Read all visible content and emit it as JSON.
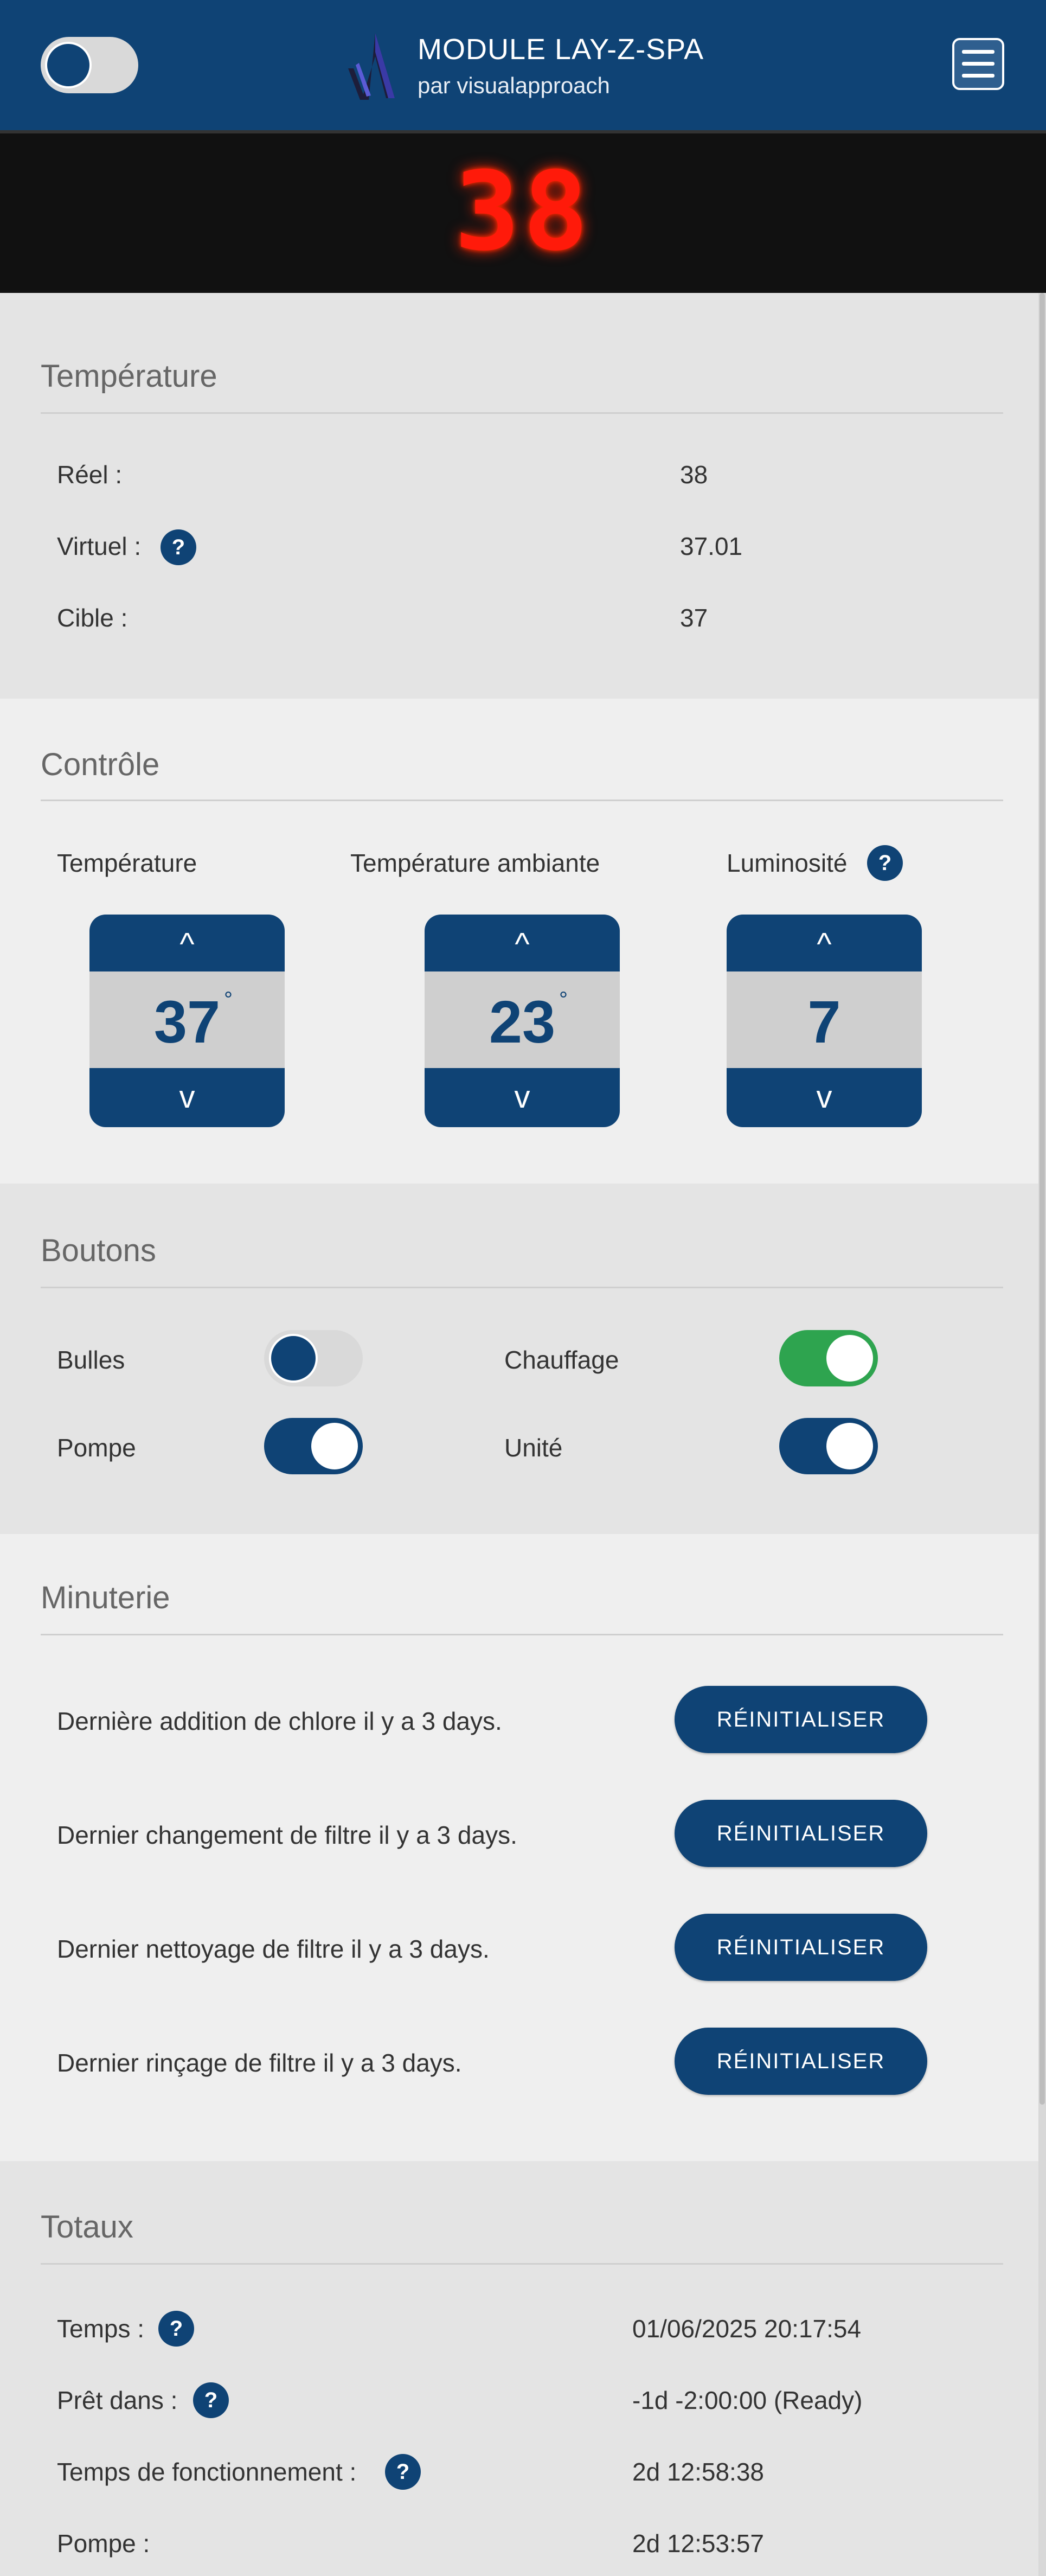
{
  "header": {
    "title": "MODULE LAY-Z-SPA",
    "subtitle": "par visualapproach",
    "power_toggle": "off",
    "logo_icon": "va-logo-icon",
    "menu_icon": "hamburger-menu-icon"
  },
  "display": {
    "value": "38",
    "color": "#ff1a0a"
  },
  "temperature": {
    "title": "Température",
    "rows": [
      {
        "label": "Réel :",
        "value": "38",
        "help": false
      },
      {
        "label": "Virtuel :",
        "value": "37.01",
        "help": true
      },
      {
        "label": "Cible :",
        "value": "37",
        "help": false
      }
    ]
  },
  "control": {
    "title": "Contrôle",
    "spinners": [
      {
        "label": "Température",
        "value": "37",
        "unit": "°",
        "help": false
      },
      {
        "label": "Température ambiante",
        "value": "23",
        "unit": "°",
        "help": true
      },
      {
        "label": "Luminosité",
        "value": "7",
        "unit": "",
        "help": true
      }
    ],
    "up_symbol": "^",
    "down_symbol": "v",
    "help_symbol": "?"
  },
  "buttons": {
    "title": "Boutons",
    "items": [
      {
        "label": "Bulles",
        "state": "off"
      },
      {
        "label": "Chauffage",
        "state": "on-green"
      },
      {
        "label": "Pompe",
        "state": "on"
      },
      {
        "label": "Unité",
        "state": "on"
      }
    ]
  },
  "timer": {
    "title": "Minuterie",
    "rows": [
      {
        "text": "Dernière addition de chlore il y a 3 days.",
        "button": "RÉINITIALISER"
      },
      {
        "text": "Dernier changement de filtre il y a 3 days.",
        "button": "RÉINITIALISER"
      },
      {
        "text": "Dernier nettoyage de filtre il y a 3 days.",
        "button": "RÉINITIALISER"
      },
      {
        "text": "Dernier rinçage de filtre il y a 3 days.",
        "button": "RÉINITIALISER"
      }
    ]
  },
  "totals": {
    "title": "Totaux",
    "rows": [
      {
        "label": "Temps :",
        "value": "01/06/2025 20:17:54",
        "help": true
      },
      {
        "label": "Prêt dans :",
        "value": "-1d -2:00:00 (Ready)",
        "help": true
      },
      {
        "label": "Temps de fonctionnement :",
        "value": "2d 12:58:38",
        "help": true
      },
      {
        "label": "Pompe :",
        "value": "2d 12:53:57",
        "help": false
      }
    ]
  },
  "colors": {
    "primary": "#0f4375",
    "green": "#2ea44f",
    "display_red": "#ff1a0a"
  }
}
